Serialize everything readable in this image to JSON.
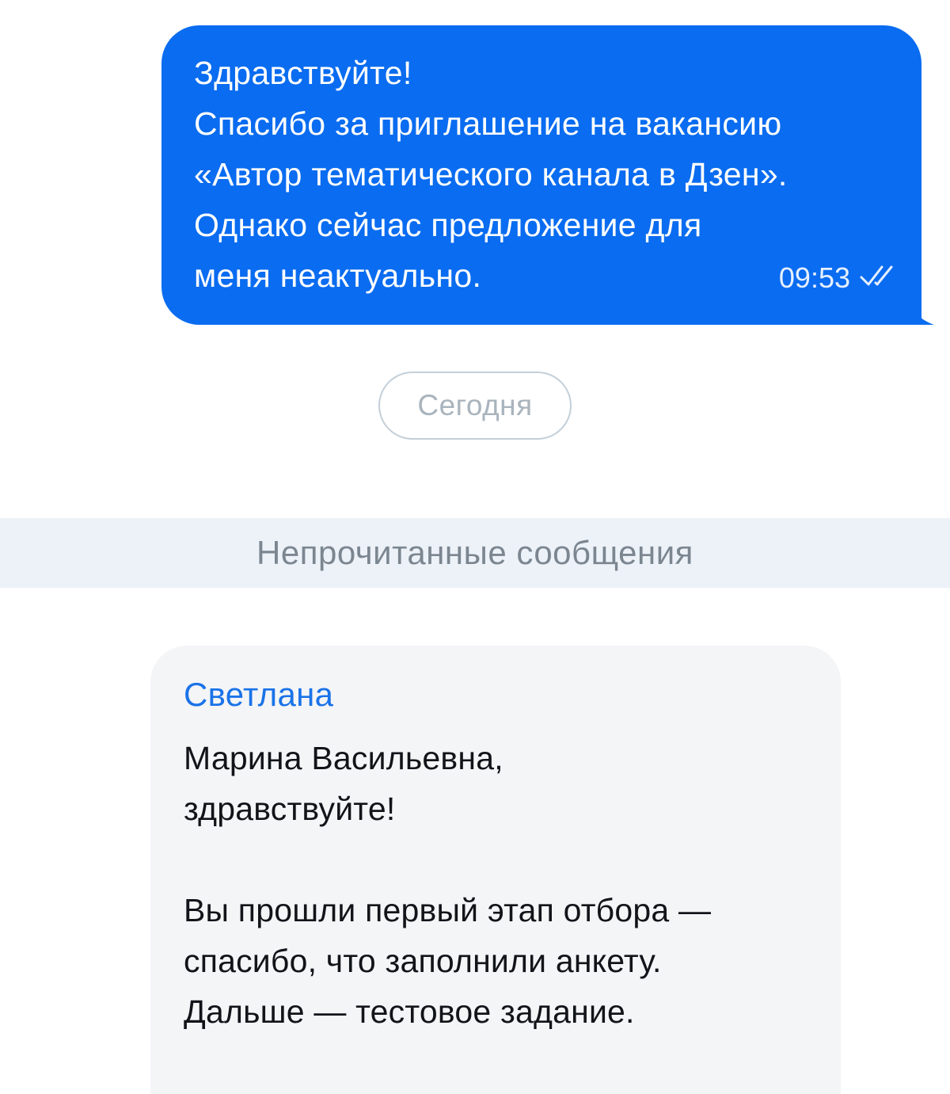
{
  "outgoing_message": {
    "lines": [
      "Здравствуйте!",
      "Спасибо за приглашение на вакансию",
      "«Автор тематического канала в Дзен».",
      "Однако сейчас предложение для",
      "меня неактуально."
    ],
    "time": "09:53",
    "status_icon": "double-check-icon",
    "bubble_color": "#0a6cf0"
  },
  "date_separator": {
    "label": "Сегодня"
  },
  "unread_divider": {
    "label": "Непрочитанные сообщения"
  },
  "incoming_message": {
    "sender": "Светлана",
    "sender_color": "#1a73e8",
    "paragraphs": [
      [
        "Марина Васильевна,",
        "здравствуйте!"
      ],
      [
        "Вы прошли первый этап отбора —",
        "спасибо, что заполнили анкету.",
        "Дальше — тестовое задание."
      ]
    ]
  }
}
